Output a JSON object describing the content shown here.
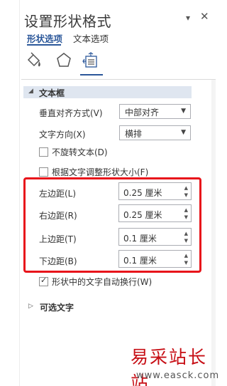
{
  "pane": {
    "title": "设置形状格式",
    "menu_glyph": "▾",
    "close_glyph": "✕"
  },
  "tabs": [
    {
      "label": "形状选项",
      "active": true
    },
    {
      "label": "文本选项",
      "active": false
    }
  ],
  "icon_tabs": [
    "fill-line-icon",
    "effects-icon",
    "layout-properties-icon"
  ],
  "textbox_section": {
    "title": "文本框",
    "vertical_align_label": "垂直对齐方式(V)",
    "vertical_align_value": "中部对齐",
    "text_direction_label": "文字方向(X)",
    "text_direction_value": "横排",
    "no_rotate_label": "不旋转文本(D)",
    "no_rotate_checked": false,
    "autofit_label": "根据文字调整形状大小(F)",
    "autofit_checked": false,
    "margins": {
      "left_label": "左边距(L)",
      "left_value": "0.25 厘米",
      "right_label": "右边距(R)",
      "right_value": "0.25 厘米",
      "top_label": "上边距(T)",
      "top_value": "0.1 厘米",
      "bottom_label": "下边距(B)",
      "bottom_value": "0.1 厘米"
    },
    "wrap_label": "形状中的文字自动换行(W)",
    "wrap_checked": true
  },
  "alt_text_section": {
    "title": "可选文字"
  },
  "watermark": {
    "cn": "易采站长站",
    "url": "www.easck.com"
  },
  "colors": {
    "accent": "#2b579a",
    "highlight": "#e8141b",
    "section_header_bg": "#dfe6f0",
    "watermark": "#c70e15"
  }
}
